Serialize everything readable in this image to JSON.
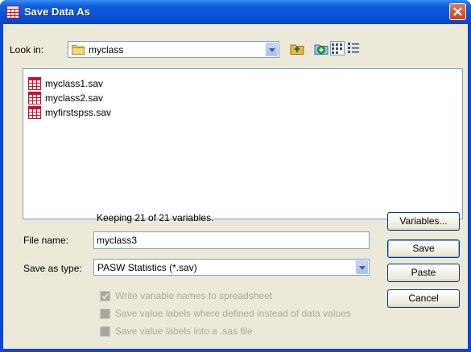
{
  "window": {
    "title": "Save Data As",
    "close_icon": "close-icon"
  },
  "lookin": {
    "label": "Look in:",
    "value": "myclass"
  },
  "files": [
    {
      "name": "myclass1.sav"
    },
    {
      "name": "myclass2.sav"
    },
    {
      "name": "myfirstspss.sav"
    }
  ],
  "info": {
    "keeping_text": "Keeping 21 of 21 variables."
  },
  "filename": {
    "label": "File name:",
    "value": "myclass3"
  },
  "savetype": {
    "label": "Save as type:",
    "value": "PASW Statistics (*.sav)"
  },
  "options": [
    {
      "label": "Write variable names to spreadsheet",
      "checked": true,
      "enabled": false
    },
    {
      "label": "Save value labels where defined instead of data values",
      "checked": false,
      "enabled": false
    },
    {
      "label": "Save value labels into a .sas file",
      "checked": false,
      "enabled": false
    }
  ],
  "buttons": {
    "variables": "Variables...",
    "save": "Save",
    "paste": "Paste",
    "cancel": "Cancel"
  },
  "colors": {
    "title_bar": "#0a4fd4",
    "dialog_bg": "#ece9d8",
    "file_icon": "#c8102e"
  }
}
